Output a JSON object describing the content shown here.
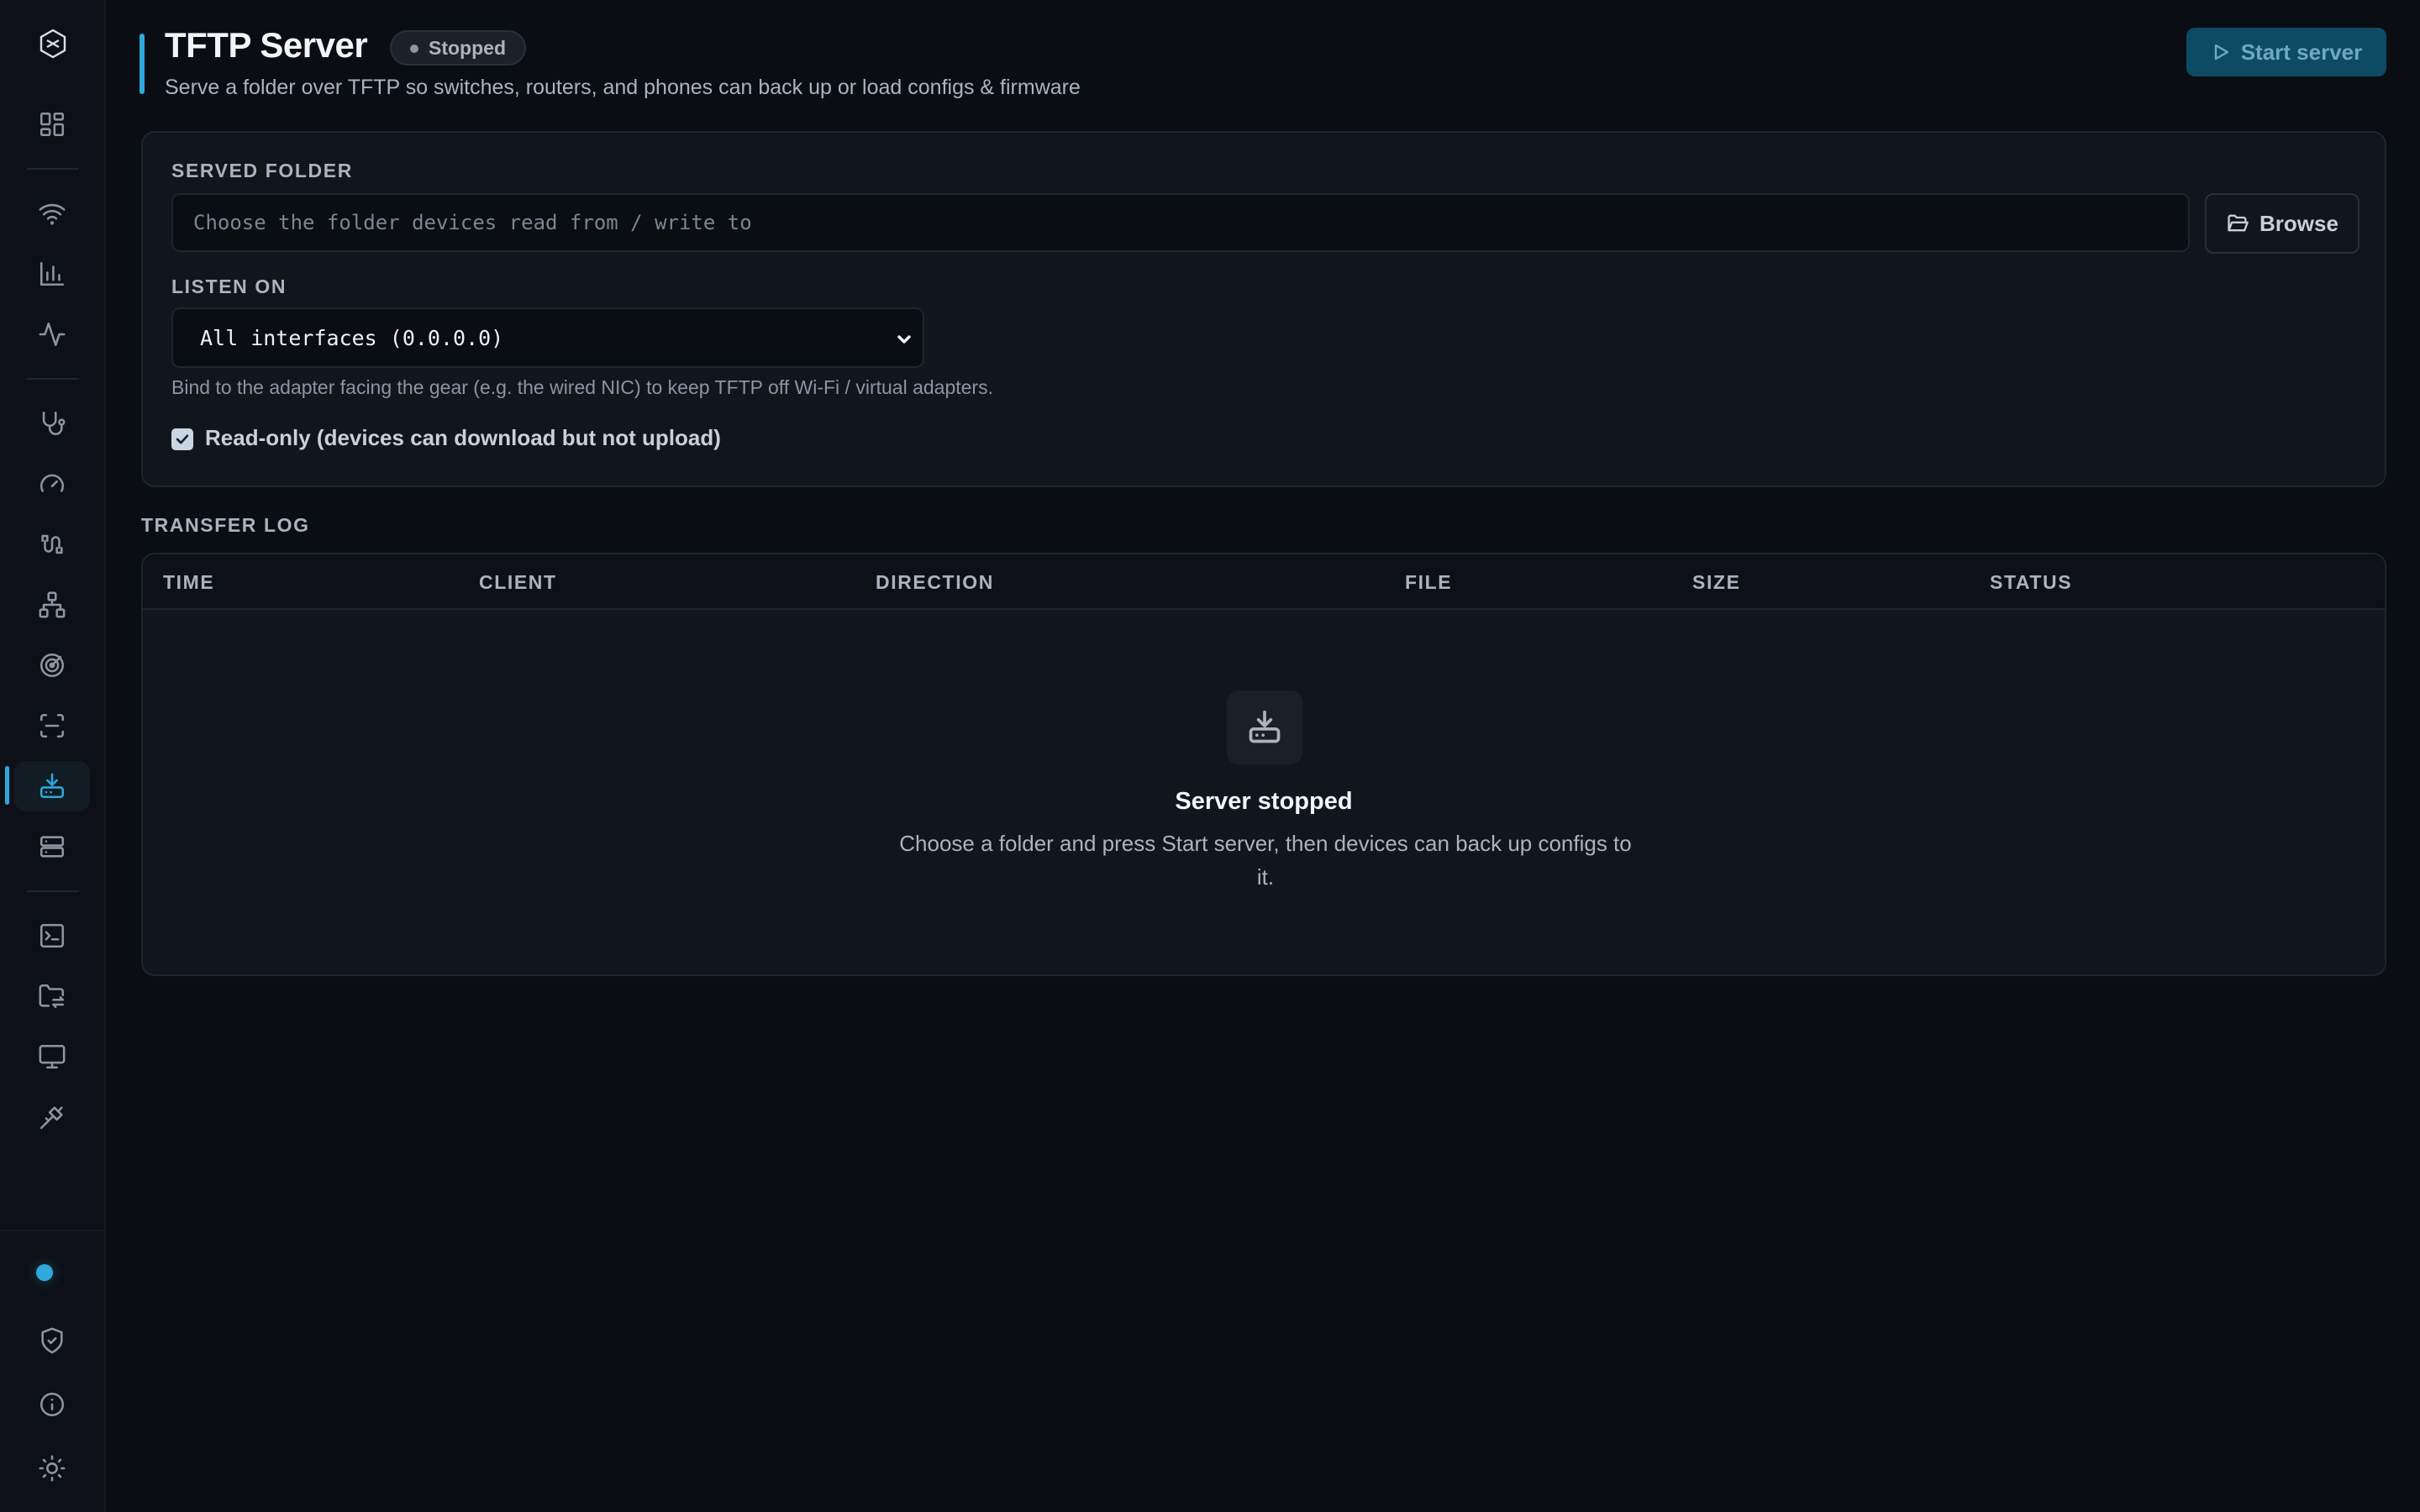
{
  "sidebar": {
    "logo_icon": "app-logo-icon",
    "items": [
      {
        "name": "dashboard",
        "icon": "grid-icon",
        "active": false
      },
      {
        "name": "wifi",
        "icon": "wifi-icon",
        "active": false
      },
      {
        "name": "charts",
        "icon": "bar-chart-icon",
        "active": false
      },
      {
        "name": "activity",
        "icon": "activity-icon",
        "active": false
      },
      {
        "name": "diagnostics",
        "icon": "stethoscope-icon",
        "active": false
      },
      {
        "name": "speed",
        "icon": "gauge-icon",
        "active": false
      },
      {
        "name": "cable",
        "icon": "cable-icon",
        "active": false
      },
      {
        "name": "topology",
        "icon": "network-icon",
        "active": false
      },
      {
        "name": "scanner",
        "icon": "radar-icon",
        "active": false
      },
      {
        "name": "scan-frame",
        "icon": "scan-icon",
        "active": false
      },
      {
        "name": "tftp",
        "icon": "download-tray-icon",
        "active": true
      },
      {
        "name": "servers",
        "icon": "server-icon",
        "active": false
      },
      {
        "name": "terminal",
        "icon": "terminal-icon",
        "active": false
      },
      {
        "name": "file-transfer",
        "icon": "folder-sync-icon",
        "active": false
      },
      {
        "name": "remote-desktop",
        "icon": "monitor-icon",
        "active": false
      },
      {
        "name": "tools",
        "icon": "plug-icon",
        "active": false
      }
    ],
    "bottom": [
      {
        "name": "status",
        "icon": "status-dot-icon"
      },
      {
        "name": "security",
        "icon": "shield-icon"
      },
      {
        "name": "about",
        "icon": "info-icon"
      },
      {
        "name": "theme",
        "icon": "sun-icon"
      }
    ]
  },
  "header": {
    "title": "TFTP Server",
    "status": "Stopped",
    "subtitle": "Serve a folder over TFTP so switches, routers, and phones can back up or load configs & firmware",
    "start_button": "Start server"
  },
  "config": {
    "folder_label": "SERVED FOLDER",
    "folder_value": "",
    "folder_placeholder": "Choose the folder devices read from / write to",
    "browse_button": "Browse",
    "listen_label": "LISTEN ON",
    "listen_value": "All interfaces (0.0.0.0)",
    "listen_hint": "Bind to the adapter facing the gear (e.g. the wired NIC) to keep TFTP off Wi-Fi / virtual adapters.",
    "readonly_checked": true,
    "readonly_label": "Read-only (devices can download but not upload)"
  },
  "log": {
    "label": "TRANSFER LOG",
    "columns": [
      "TIME",
      "CLIENT",
      "DIRECTION",
      "FILE",
      "SIZE",
      "STATUS"
    ],
    "rows": [],
    "empty_title": "Server stopped",
    "empty_text": "Choose a folder and press Start server, then devices can back up configs to it."
  },
  "colors": {
    "accent": "#2fa8dc",
    "background": "#0a0e13",
    "card": "#11161d"
  }
}
